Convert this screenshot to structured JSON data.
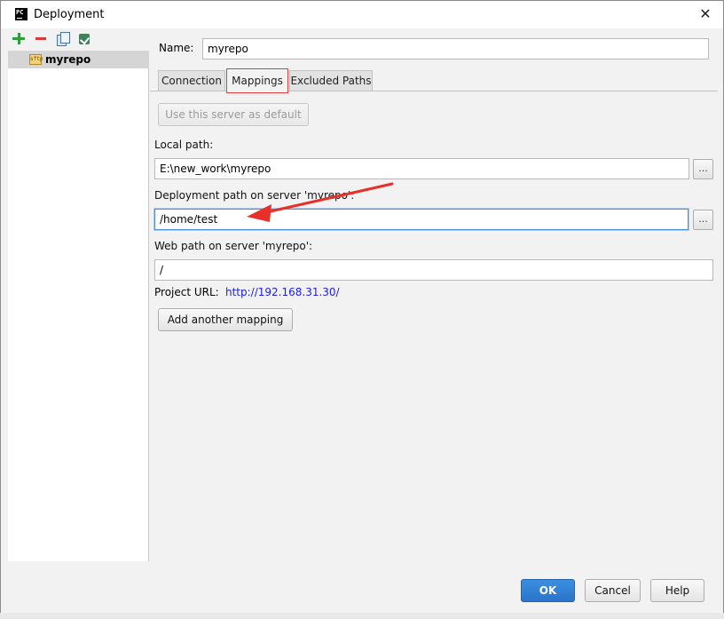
{
  "window": {
    "title": "Deployment",
    "app_icon_text": "PC"
  },
  "sidebar": {
    "toolbar_icons": [
      "add-icon",
      "remove-icon",
      "copy-icon",
      "use-as-default-icon"
    ],
    "servers": [
      {
        "icon": "sftp-icon",
        "icon_text": "sftp",
        "label": "myrepo"
      }
    ]
  },
  "form": {
    "name_label": "Name:",
    "name_value": "myrepo"
  },
  "tabs": [
    {
      "label": "Connection"
    },
    {
      "label": "Mappings",
      "selected": true
    },
    {
      "label": "Excluded Paths"
    }
  ],
  "mappings": {
    "use_default_button": "Use this server as default",
    "local_path_label": "Local path:",
    "local_path_value": "E:\\new_work\\myrepo",
    "deployment_path_label": "Deployment path on server 'myrepo':",
    "deployment_path_value": "/home/test",
    "web_path_label": "Web path on server 'myrepo':",
    "web_path_value": "/",
    "project_url_label": "Project URL:",
    "project_url_value": "http://192.168.31.30/",
    "add_mapping_button": "Add another mapping",
    "browse_label": "..."
  },
  "footer": {
    "ok": "OK",
    "cancel": "Cancel",
    "help": "Help"
  },
  "colors": {
    "annotation_red": "#e8302a",
    "ok_blue": "#2a74c9",
    "link_blue": "#1a1aff"
  }
}
